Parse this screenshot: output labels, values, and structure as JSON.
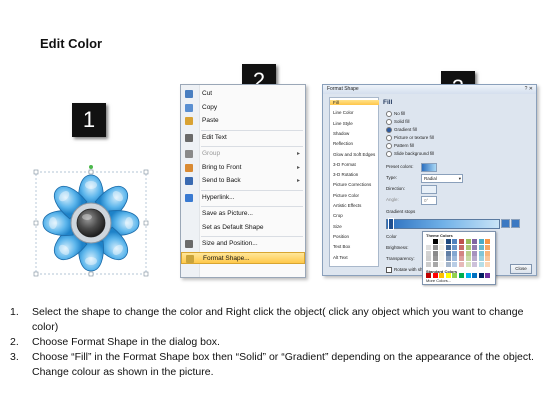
{
  "title": "Edit Color",
  "badges": {
    "one": "1",
    "two": "2",
    "three": "3"
  },
  "context_menu": {
    "items": [
      {
        "label": "Cut",
        "icon": "cut-icon",
        "enabled": true,
        "submenu": false
      },
      {
        "label": "Copy",
        "icon": "copy-icon",
        "enabled": true,
        "submenu": false
      },
      {
        "label": "Paste",
        "icon": "paste-icon",
        "enabled": true,
        "submenu": false
      },
      {
        "label": "Edit Text",
        "icon": "edit-text-icon",
        "enabled": true,
        "submenu": false
      },
      {
        "label": "Group",
        "icon": "group-icon",
        "enabled": false,
        "submenu": true
      },
      {
        "label": "Bring to Front",
        "icon": "bring-front-icon",
        "enabled": true,
        "submenu": true
      },
      {
        "label": "Send to Back",
        "icon": "send-back-icon",
        "enabled": true,
        "submenu": true
      },
      {
        "label": "Hyperlink...",
        "icon": "hyperlink-icon",
        "enabled": true,
        "submenu": false
      },
      {
        "label": "Save as Picture...",
        "icon": "",
        "enabled": true,
        "submenu": false
      },
      {
        "label": "Set as Default Shape",
        "icon": "",
        "enabled": true,
        "submenu": false
      },
      {
        "label": "Size and Position...",
        "icon": "size-position-icon",
        "enabled": true,
        "submenu": false
      },
      {
        "label": "Format Shape...",
        "icon": "format-shape-icon",
        "enabled": true,
        "submenu": false,
        "selected": true
      }
    ]
  },
  "dialog": {
    "title": "Format Shape",
    "nav": [
      "Fill",
      "Line Color",
      "Line Style",
      "Shadow",
      "Reflection",
      "Glow and Soft Edges",
      "3-D Format",
      "3-D Rotation",
      "Picture Corrections",
      "Picture Color",
      "Artistic Effects",
      "Crop",
      "Size",
      "Position",
      "Text Box",
      "Alt Text"
    ],
    "selected_nav": "Fill",
    "heading": "Fill",
    "fill_options": [
      "No fill",
      "Solid fill",
      "Gradient fill",
      "Picture or texture fill",
      "Pattern fill",
      "Slide background fill"
    ],
    "selected_fill": "Gradient fill",
    "preset_colors_label": "Preset colors:",
    "type_label": "Type:",
    "type_value": "Radial",
    "direction_label": "Direction:",
    "angle_label": "Angle:",
    "angle_value": "0°",
    "gradient_stops_label": "Gradient stops",
    "color_label": "Color",
    "position_label": "Position:",
    "position_value": "0%",
    "brightness_label": "Brightness:",
    "transparency_label": "Transparency:",
    "rotate_label": "Rotate with shape",
    "close_label": "Close",
    "palette": {
      "theme_label": "Theme Colors",
      "standard_label": "Standard Colors",
      "more_label": "More Colors..."
    }
  },
  "steps": [
    {
      "num": "1.",
      "text": "Select the shape to change the color and Right click the object( click any object which you want to change color)"
    },
    {
      "num": "2.",
      "text": "Choose Format Shape in the dialog box."
    },
    {
      "num": "3.",
      "text": "Choose “Fill” in the Format Shape box then “Solid” or “Gradient” depending on the appearance of the object. Change colour as shown in the picture."
    }
  ],
  "colors": {
    "accent": "#ffc84a",
    "petal": "#3fa3e0",
    "petal_light": "#a9d8f5",
    "center": "#3c3c3c"
  }
}
